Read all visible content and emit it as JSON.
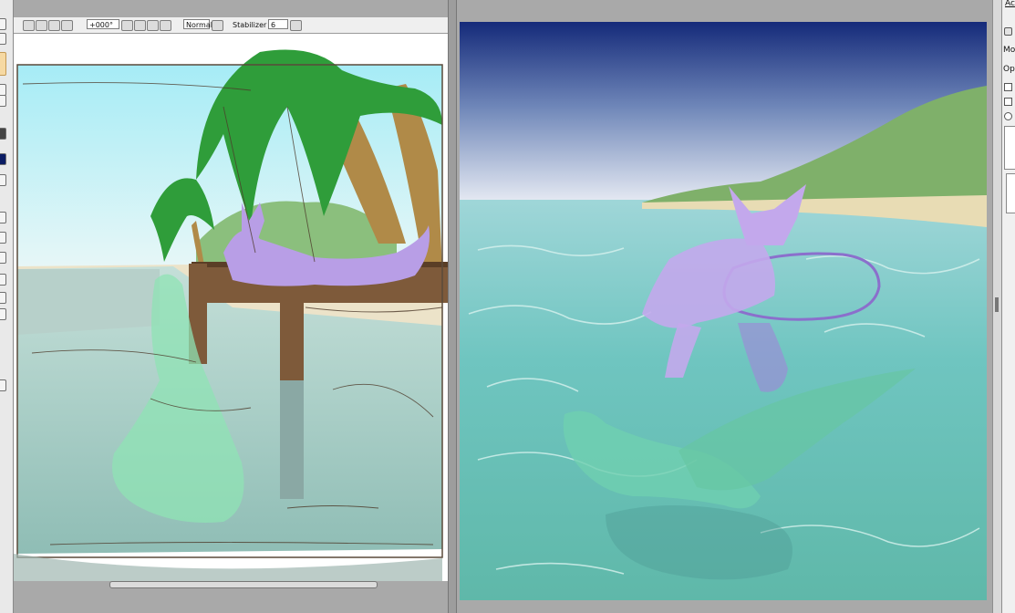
{
  "toolbar": {
    "rotation_value": "+000°",
    "blend_mode": "Normal",
    "stabilizer_label": "Stabilizer",
    "stabilizer_value": "6"
  },
  "side_panel": {
    "header": "Ac",
    "mode_label": "Mo",
    "opacity_label": "Op"
  },
  "icons": {
    "rotation_dropdown": "chevron-down-icon",
    "stabilizer_dropdown": "chevron-down-icon",
    "add_layer": "plus-icon"
  },
  "colors": {
    "app_background": "#a9a9a9",
    "toolbar_background": "#efefef",
    "selected_tool": "#f6d9a3",
    "active_color_swatch": "#0b1c63"
  }
}
